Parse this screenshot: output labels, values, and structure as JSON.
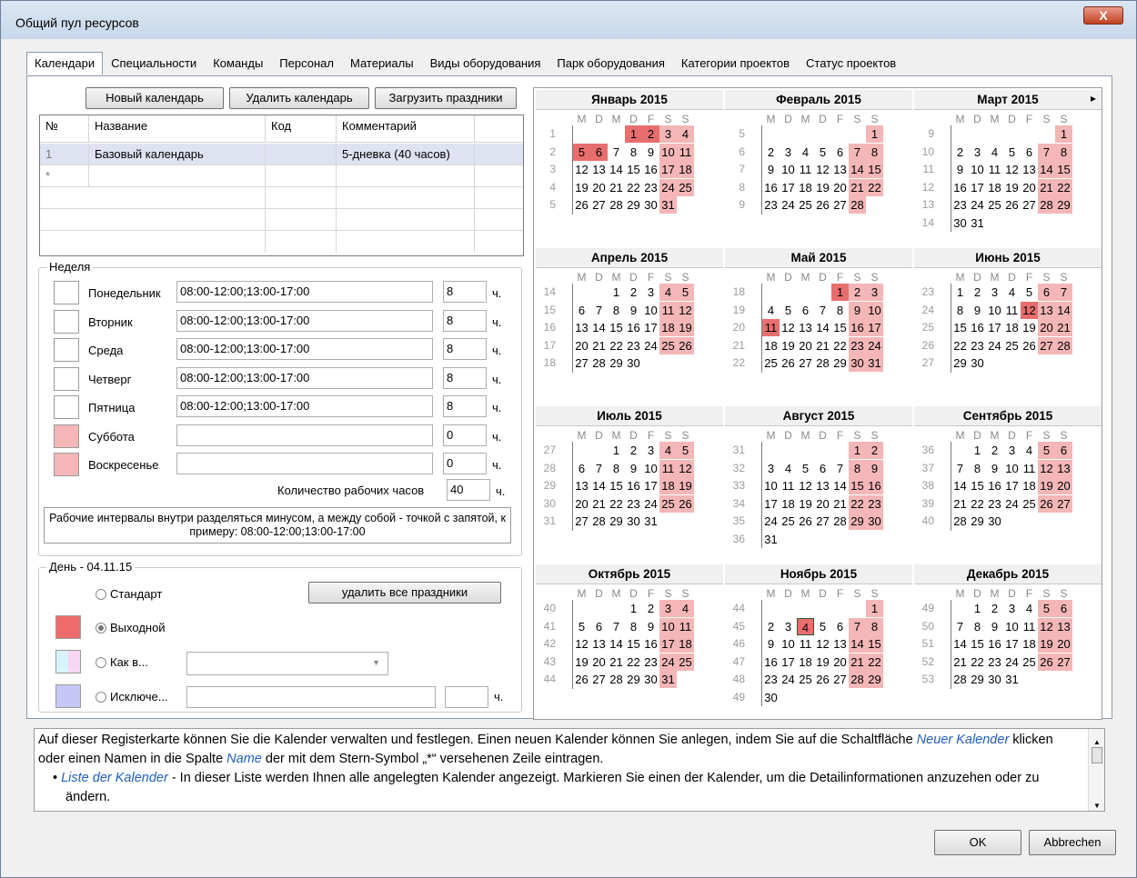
{
  "window": {
    "title": "Общий пул ресурсов",
    "close_glyph": "X"
  },
  "tabs": [
    "Календари",
    "Специальности",
    "Команды",
    "Персонал",
    "Материалы",
    "Виды оборудования",
    "Парк оборудования",
    "Категории проектов",
    "Статус проектов"
  ],
  "toolbar": {
    "new_calendar": "Новый календарь",
    "delete_calendar": "Удалить календарь",
    "load_holidays": "Загрузить праздники"
  },
  "calendar_table": {
    "headers": [
      "№",
      "Название",
      "Код",
      "Комментарий"
    ],
    "rows": [
      [
        "1",
        "Базовый календарь",
        "",
        "5-дневка (40 часов)"
      ]
    ],
    "new_row_marker": "*"
  },
  "week": {
    "title": "Неделя",
    "days": [
      {
        "name": "Понедельник",
        "interval": "08:00-12:00;13:00-17:00",
        "hours": "8",
        "color": "#ffffff"
      },
      {
        "name": "Вторник",
        "interval": "08:00-12:00;13:00-17:00",
        "hours": "8",
        "color": "#ffffff"
      },
      {
        "name": "Среда",
        "interval": "08:00-12:00;13:00-17:00",
        "hours": "8",
        "color": "#ffffff"
      },
      {
        "name": "Четверг",
        "interval": "08:00-12:00;13:00-17:00",
        "hours": "8",
        "color": "#ffffff"
      },
      {
        "name": "Пятница",
        "interval": "08:00-12:00;13:00-17:00",
        "hours": "8",
        "color": "#ffffff"
      },
      {
        "name": "Суббота",
        "interval": "",
        "hours": "0",
        "color": "#f4b6b6"
      },
      {
        "name": "Воскресенье",
        "interval": "",
        "hours": "0",
        "color": "#f4b6b6"
      }
    ],
    "unit": "ч.",
    "total_label": "Количество рабочих часов",
    "total_hours": "40",
    "note": "Рабочие интервалы внутри разделяться минусом, а между собой - точкой с запятой, к примеру: 08:00-12:00;13:00-17:00"
  },
  "day": {
    "title": "День - 04.11.15",
    "standard": "Стандарт",
    "weekend": "Выходной",
    "like": "Как в...",
    "exception": "Исключе...",
    "delete_all_holidays": "удалить все праздники",
    "unit": "ч.",
    "selected": "weekend"
  },
  "weekday_letters": [
    "M",
    "D",
    "M",
    "D",
    "F",
    "S",
    "S"
  ],
  "months": [
    {
      "name": "Январь 2015",
      "offset": 3,
      "days": 31,
      "week_start": 1,
      "holidays": [
        1,
        2,
        5,
        6
      ]
    },
    {
      "name": "Февраль 2015",
      "offset": 6,
      "days": 28,
      "week_start": 5,
      "holidays": []
    },
    {
      "name": "Март 2015",
      "offset": 6,
      "days": 31,
      "week_start": 9,
      "holidays": []
    },
    {
      "name": "Апрель 2015",
      "offset": 2,
      "days": 30,
      "week_start": 14,
      "holidays": []
    },
    {
      "name": "Май 2015",
      "offset": 4,
      "days": 31,
      "week_start": 18,
      "holidays": [
        1,
        11
      ]
    },
    {
      "name": "Июнь 2015",
      "offset": 0,
      "days": 30,
      "week_start": 23,
      "holidays": [
        12
      ]
    },
    {
      "name": "Июль 2015",
      "offset": 2,
      "days": 31,
      "week_start": 27,
      "holidays": []
    },
    {
      "name": "Август 2015",
      "offset": 5,
      "days": 31,
      "week_start": 31,
      "holidays": []
    },
    {
      "name": "Сентябрь 2015",
      "offset": 1,
      "days": 30,
      "week_start": 36,
      "holidays": []
    },
    {
      "name": "Октябрь 2015",
      "offset": 3,
      "days": 31,
      "week_start": 40,
      "holidays": []
    },
    {
      "name": "Ноябрь 2015",
      "offset": 6,
      "days": 30,
      "week_start": 44,
      "holidays": [
        4
      ],
      "today": 4
    },
    {
      "name": "Декабрь 2015",
      "offset": 1,
      "days": 31,
      "week_start": 49,
      "holidays": []
    }
  ],
  "nav": {
    "prev": "◂",
    "next": "▸"
  },
  "help": {
    "p1_a": "Auf dieser Registerkarte können Sie die Kalender verwalten und festlegen. Einen neuen Kalender können Sie anlegen, indem Sie auf die Schaltfläche ",
    "p1_link": "Neuer Kalender",
    "p1_b": " klicken oder einen Namen in die Spalte ",
    "p1_link2": "Name",
    "p1_c": " der mit dem Stern-Symbol „*“ versehenen Zeile eintragen.",
    "li_link": "Liste der Kalender",
    "li_text": " - In dieser Liste werden Ihnen alle angelegten Kalender angezeigt. Markieren Sie einen der Kalender, um die Detailinformationen anzuzehen oder zu ändern."
  },
  "footer": {
    "ok": "OK",
    "cancel": "Abbrechen"
  },
  "colors": {
    "weekend": "#f4b6b6",
    "holiday": "#e86e6e",
    "like_a": "#d8f4fb",
    "like_b": "#f6d6f3",
    "exception": "#c6c6f7"
  }
}
